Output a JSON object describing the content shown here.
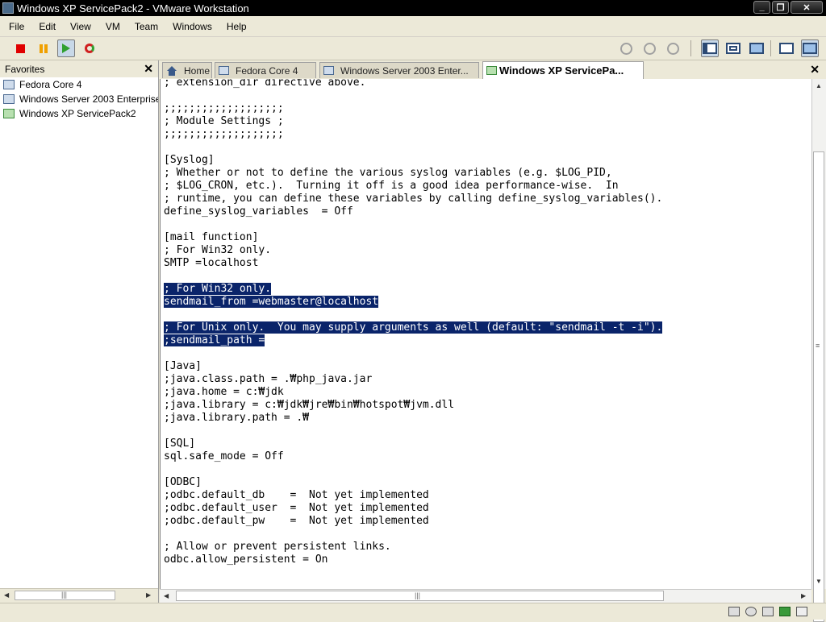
{
  "window": {
    "title": "Windows XP ServicePack2 - VMware Workstation"
  },
  "menu": [
    "File",
    "Edit",
    "View",
    "VM",
    "Team",
    "Windows",
    "Help"
  ],
  "toolbar": {
    "left": [
      "power-off-icon",
      "suspend-icon",
      "power-on-icon",
      "reset-icon"
    ],
    "snapshots": [
      "snapshot-take-icon",
      "snapshot-revert-icon",
      "snapshot-manager-icon"
    ],
    "views": [
      "show-favorites-icon",
      "quick-switch-icon",
      "full-screen-icon"
    ],
    "right": [
      "summary-view-icon",
      "console-view-icon"
    ]
  },
  "favorites": {
    "title": "Favorites",
    "items": [
      {
        "label": "Fedora Core 4",
        "running": false
      },
      {
        "label": "Windows Server 2003 Enterprise",
        "running": false
      },
      {
        "label": "Windows XP ServicePack2",
        "running": true
      }
    ]
  },
  "tabs": [
    {
      "label": "Home",
      "icon": "home-icon",
      "active": false
    },
    {
      "label": "Fedora Core 4",
      "icon": "vm-icon",
      "active": false
    },
    {
      "label": "Windows Server 2003 Enter...",
      "icon": "vm-icon",
      "active": false
    },
    {
      "label": "Windows XP ServicePa...",
      "icon": "vm-running-icon",
      "active": true
    }
  ],
  "console": {
    "lines": [
      {
        "text": "; extension_dir directive above.",
        "hl": false
      },
      {
        "text": "",
        "hl": false
      },
      {
        "text": ";;;;;;;;;;;;;;;;;;;",
        "hl": false
      },
      {
        "text": "; Module Settings ;",
        "hl": false
      },
      {
        "text": ";;;;;;;;;;;;;;;;;;;",
        "hl": false
      },
      {
        "text": "",
        "hl": false
      },
      {
        "text": "[Syslog]",
        "hl": false
      },
      {
        "text": "; Whether or not to define the various syslog variables (e.g. $LOG_PID,",
        "hl": false
      },
      {
        "text": "; $LOG_CRON, etc.).  Turning it off is a good idea performance-wise.  In",
        "hl": false
      },
      {
        "text": "; runtime, you can define these variables by calling define_syslog_variables().",
        "hl": false
      },
      {
        "text": "define_syslog_variables  = Off",
        "hl": false
      },
      {
        "text": "",
        "hl": false
      },
      {
        "text": "[mail function]",
        "hl": false
      },
      {
        "text": "; For Win32 only.",
        "hl": false
      },
      {
        "text": "SMTP =localhost",
        "hl": false
      },
      {
        "text": "",
        "hl": false
      },
      {
        "text": "; For Win32 only.",
        "hl": true
      },
      {
        "text": "sendmail_from =webmaster@localhost",
        "hl": true
      },
      {
        "text": "",
        "hl": false
      },
      {
        "text": "; For Unix only.  You may supply arguments as well (default: \"sendmail -t -i\").",
        "hl": true
      },
      {
        "text": ";sendmail_path =",
        "hl": true
      },
      {
        "text": "",
        "hl": false
      },
      {
        "text": "[Java]",
        "hl": false
      },
      {
        "text": ";java.class.path = .₩php_java.jar",
        "hl": false
      },
      {
        "text": ";java.home = c:₩jdk",
        "hl": false
      },
      {
        "text": ";java.library = c:₩jdk₩jre₩bin₩hotspot₩jvm.dll",
        "hl": false
      },
      {
        "text": ";java.library.path = .₩",
        "hl": false
      },
      {
        "text": "",
        "hl": false
      },
      {
        "text": "[SQL]",
        "hl": false
      },
      {
        "text": "sql.safe_mode = Off",
        "hl": false
      },
      {
        "text": "",
        "hl": false
      },
      {
        "text": "[ODBC]",
        "hl": false
      },
      {
        "text": ";odbc.default_db    =  Not yet implemented",
        "hl": false
      },
      {
        "text": ";odbc.default_user  =  Not yet implemented",
        "hl": false
      },
      {
        "text": ";odbc.default_pw    =  Not yet implemented",
        "hl": false
      },
      {
        "text": "",
        "hl": false
      },
      {
        "text": "; Allow or prevent persistent links.",
        "hl": false
      },
      {
        "text": "odbc.allow_persistent = On",
        "hl": false
      },
      {
        "text": "",
        "hl": false
      }
    ]
  },
  "colors": {
    "selection": "#0a246a",
    "titlebar": "#000000"
  },
  "status_icons": [
    "floppy-icon",
    "cdrom-icon",
    "hard-disk-icon",
    "network-icon",
    "sound-icon"
  ]
}
